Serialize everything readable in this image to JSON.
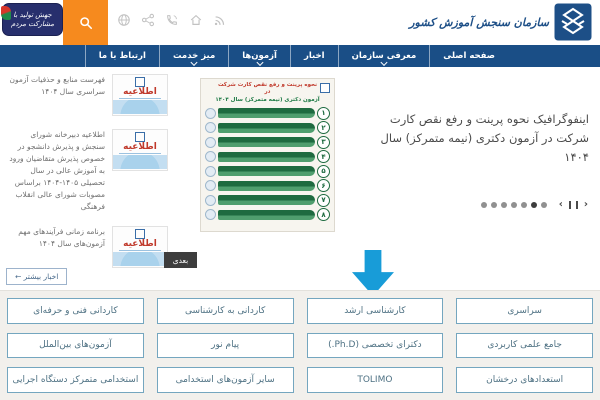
{
  "colors": {
    "nav_blue": "#1a4e86",
    "accent_orange": "#f68a1e",
    "arrow_blue": "#189cd8",
    "badge_red": "#c0392b",
    "button_border": "#74a6bf",
    "infographic_green": "#1e6b40"
  },
  "header": {
    "logo_text": "سازمان سنجش آموزش کشور",
    "slogan_banner": "جهش تولید با مشارکت مردم",
    "icons": [
      "globe-icon",
      "share-icon",
      "phone-icon",
      "home-icon",
      "rss-icon"
    ]
  },
  "nav": {
    "items": [
      {
        "label": "صفحه اصلی",
        "dropdown": false
      },
      {
        "label": "معرفی سازمان",
        "dropdown": true
      },
      {
        "label": "اخبار",
        "dropdown": false
      },
      {
        "label": "آزمون‌ها",
        "dropdown": true
      },
      {
        "label": "میز خدمت",
        "dropdown": true
      },
      {
        "label": "ارتباط با ما",
        "dropdown": false
      }
    ]
  },
  "news": {
    "items": [
      {
        "text": "فهرست منابع و حذفیات آزمون سراسری سال ۱۴۰۴",
        "badge": "اطلاعیه"
      },
      {
        "text": "اطلاعیه دبیرخانه شورای سنجش و پذیرش دانشجو در خصوص پذیرش متقاضیان ورود به آموزش عالی در سال تحصیلی ۱۴۰۵-۱۴۰۴ براساس مصوبات شورای عالی انقلاب فرهنگی",
        "badge": "اطلاعیه"
      },
      {
        "text": "برنامه زمانی فرآیندهای مهم آزمون‌های سال ۱۴۰۴",
        "badge": "اطلاعیه"
      }
    ],
    "next_button": "بعدی",
    "more_link": "اخبار بیشتر ←"
  },
  "slider": {
    "headline": "اینفوگرافیک نحوه پرینت و رفع نقص کارت شرکت در آزمون دکتری (نیمه متمرکز) سال ۱۴۰۴",
    "dots": [
      {
        "active": false
      },
      {
        "active": false
      },
      {
        "active": false
      },
      {
        "active": false
      },
      {
        "active": false
      },
      {
        "active": true
      },
      {
        "active": false
      }
    ],
    "controls": {
      "prev": "‹",
      "next": "›"
    }
  },
  "infographic": {
    "title_line1": "نحوه پرینت و رفع نقص کارت شرکت در",
    "title_line2": "آزمون دکتری (نیمه متمرکز) سال ۱۴۰۴",
    "steps": [
      {
        "num": "۱"
      },
      {
        "num": "۲"
      },
      {
        "num": "۳"
      },
      {
        "num": "۴"
      },
      {
        "num": "۵"
      },
      {
        "num": "۶"
      },
      {
        "num": "۷"
      },
      {
        "num": "۸"
      }
    ]
  },
  "exam_buttons": [
    "سراسری",
    "کارشناسی ارشد",
    "کاردانی به کارشناسی",
    "کاردانی فنی و حرفه‌ای",
    "جامع علمی کاربردی",
    "دکترای تخصصی (Ph.D.)",
    "پیام نور",
    "آزمون‌های بین‌الملل",
    "استعدادهای درخشان",
    "TOLIMO",
    "سایر آزمون‌های استخدامی",
    "استخدامی متمرکز دستگاه اجرایی"
  ]
}
